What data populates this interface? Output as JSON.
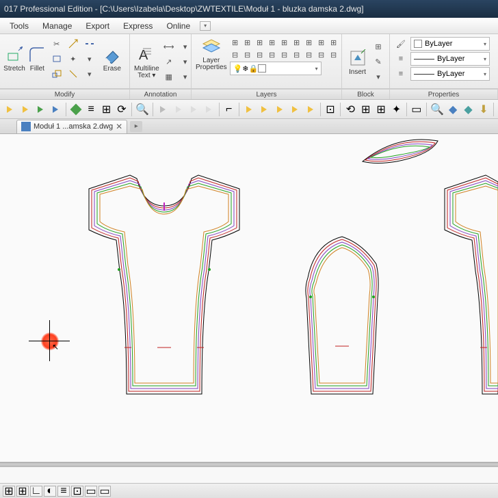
{
  "title": "017 Professional Edition - [C:\\Users\\Izabela\\Desktop\\ZWTEXTILE\\Moduł 1 - bluzka damska 2.dwg]",
  "menu": {
    "tools": "Tools",
    "manage": "Manage",
    "export": "Export",
    "express": "Express",
    "online": "Online"
  },
  "ribbon": {
    "stretch": "Stretch",
    "fillet": "Fillet",
    "erase": "Erase",
    "multiline_text": "Multiline\nText ▾",
    "layer_properties": "Layer\nProperties",
    "insert": "Insert",
    "bylayer": "ByLayer",
    "groups": {
      "modify": "Modify",
      "annotation": "Annotation",
      "layers": "Layers",
      "block": "Block",
      "properties": "Properties"
    }
  },
  "doctab": {
    "name": "Moduł 1 ...amska 2.dwg"
  }
}
